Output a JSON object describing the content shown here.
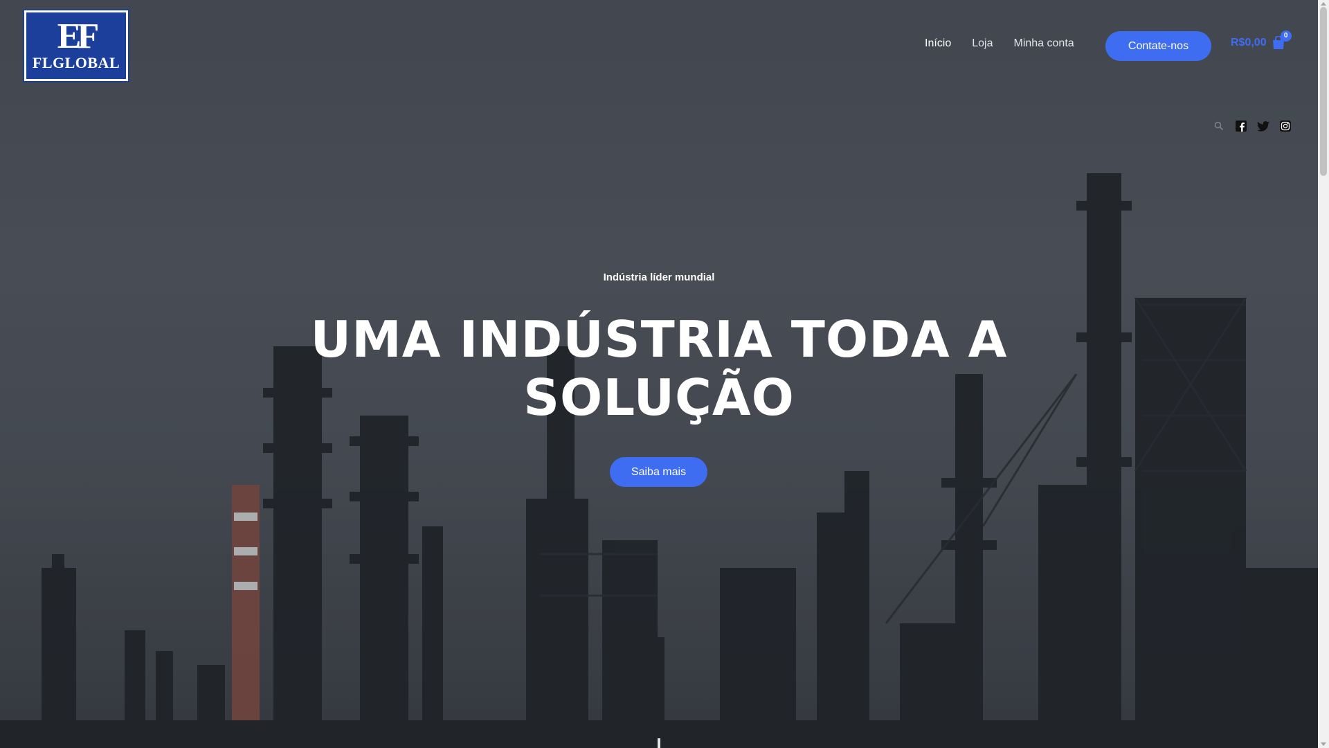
{
  "header": {
    "logo_mark": "EF",
    "logo_text": "FLGLOBAL",
    "nav": [
      {
        "label": "Início",
        "active": true
      },
      {
        "label": "Loja",
        "active": false
      },
      {
        "label": "Minha conta",
        "active": false
      }
    ],
    "contact_label": "Contate-nos",
    "cart_total": "R$0,00",
    "cart_count": "0"
  },
  "utility_icons": [
    "search-icon",
    "facebook-icon",
    "twitter-icon",
    "instagram-icon"
  ],
  "hero": {
    "kicker": "Indústria líder mundial",
    "headline": "UMA INDÚSTRIA TODA A SOLUÇÃO",
    "cta_label": "Saiba mais"
  },
  "colors": {
    "accent": "#3f6df2",
    "logo_bg": "#1b3f9b",
    "text": "#ffffff"
  }
}
